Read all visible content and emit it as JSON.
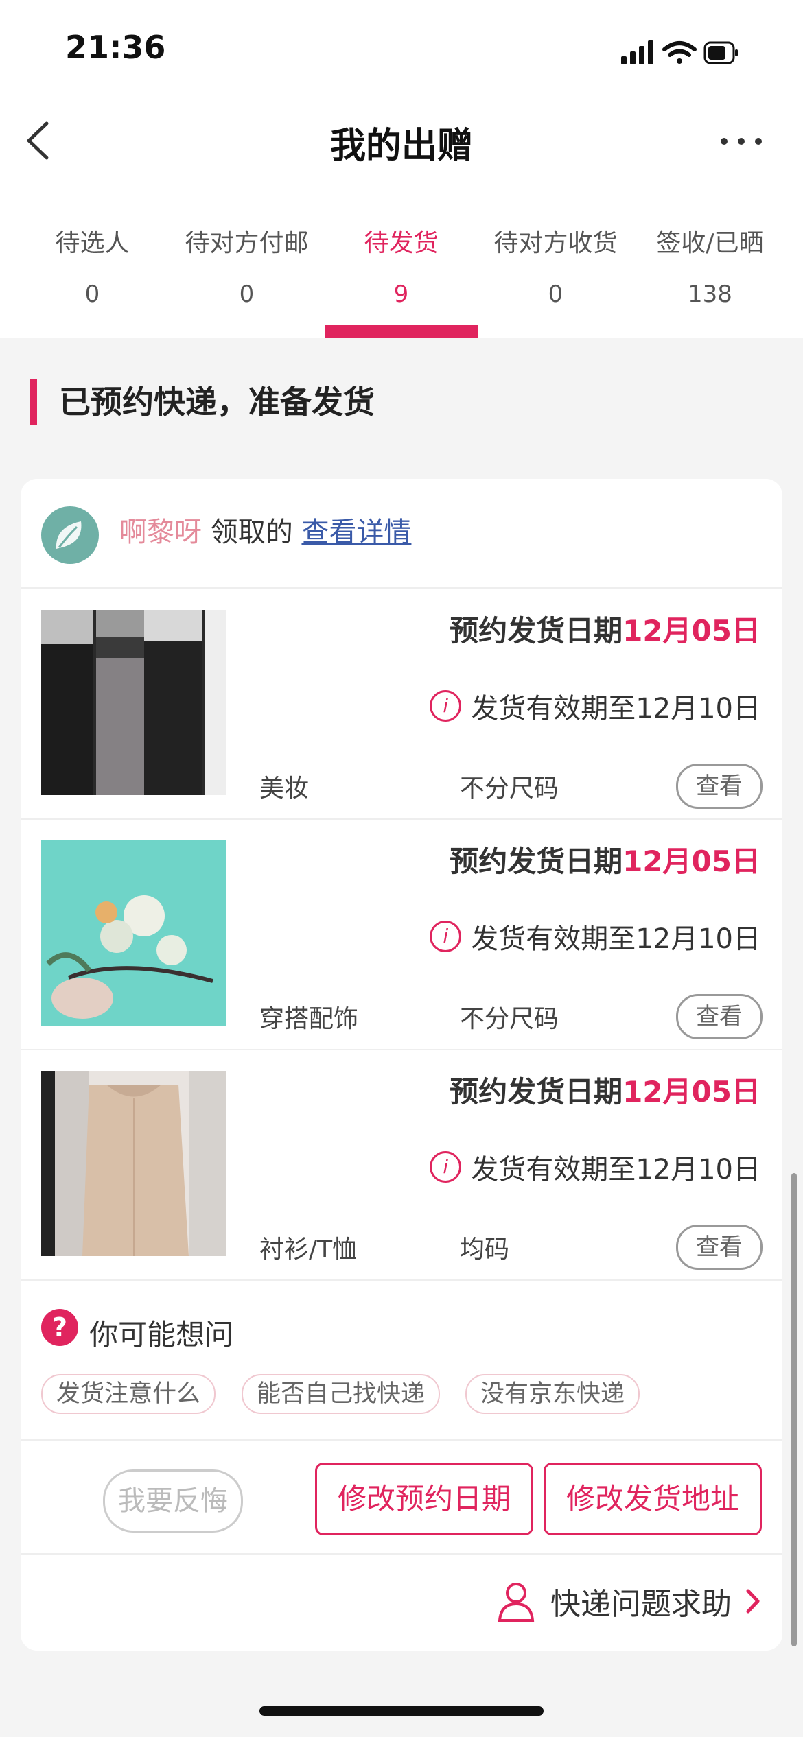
{
  "status_bar": {
    "time": "21:36"
  },
  "header": {
    "title": "我的出赠"
  },
  "tabs": [
    {
      "label": "待选人",
      "count": "0"
    },
    {
      "label": "待对方付邮",
      "count": "0"
    },
    {
      "label": "待发货",
      "count": "9"
    },
    {
      "label": "待对方收货",
      "count": "0"
    },
    {
      "label": "签收/已晒",
      "count": "138"
    }
  ],
  "section": {
    "title": "已预约快递，准备发货"
  },
  "order": {
    "recipient": "啊黎呀",
    "claimed_text": "领取的",
    "details_link": "查看详情"
  },
  "items": [
    {
      "date_label": "预约发货日期",
      "date": "12月05日",
      "validity": "发货有效期至12月10日",
      "category": "美妆",
      "size": "不分尺码",
      "view_label": "查看"
    },
    {
      "date_label": "预约发货日期",
      "date": "12月05日",
      "validity": "发货有效期至12月10日",
      "category": "穿搭配饰",
      "size": "不分尺码",
      "view_label": "查看"
    },
    {
      "date_label": "预约发货日期",
      "date": "12月05日",
      "validity": "发货有效期至12月10日",
      "category": "衬衫/T恤",
      "size": "均码",
      "view_label": "查看"
    }
  ],
  "faq": {
    "title": "你可能想问",
    "chips": [
      "发货注意什么",
      "能否自己找快递",
      "没有京东快递"
    ]
  },
  "actions": {
    "regret": "我要反悔",
    "change_date": "修改预约日期",
    "change_address": "修改发货地址"
  },
  "help": {
    "label": "快递问题求助"
  },
  "colors": {
    "accent": "#e0245e",
    "link": "#3a5aa8",
    "name": "#e48a9a"
  }
}
